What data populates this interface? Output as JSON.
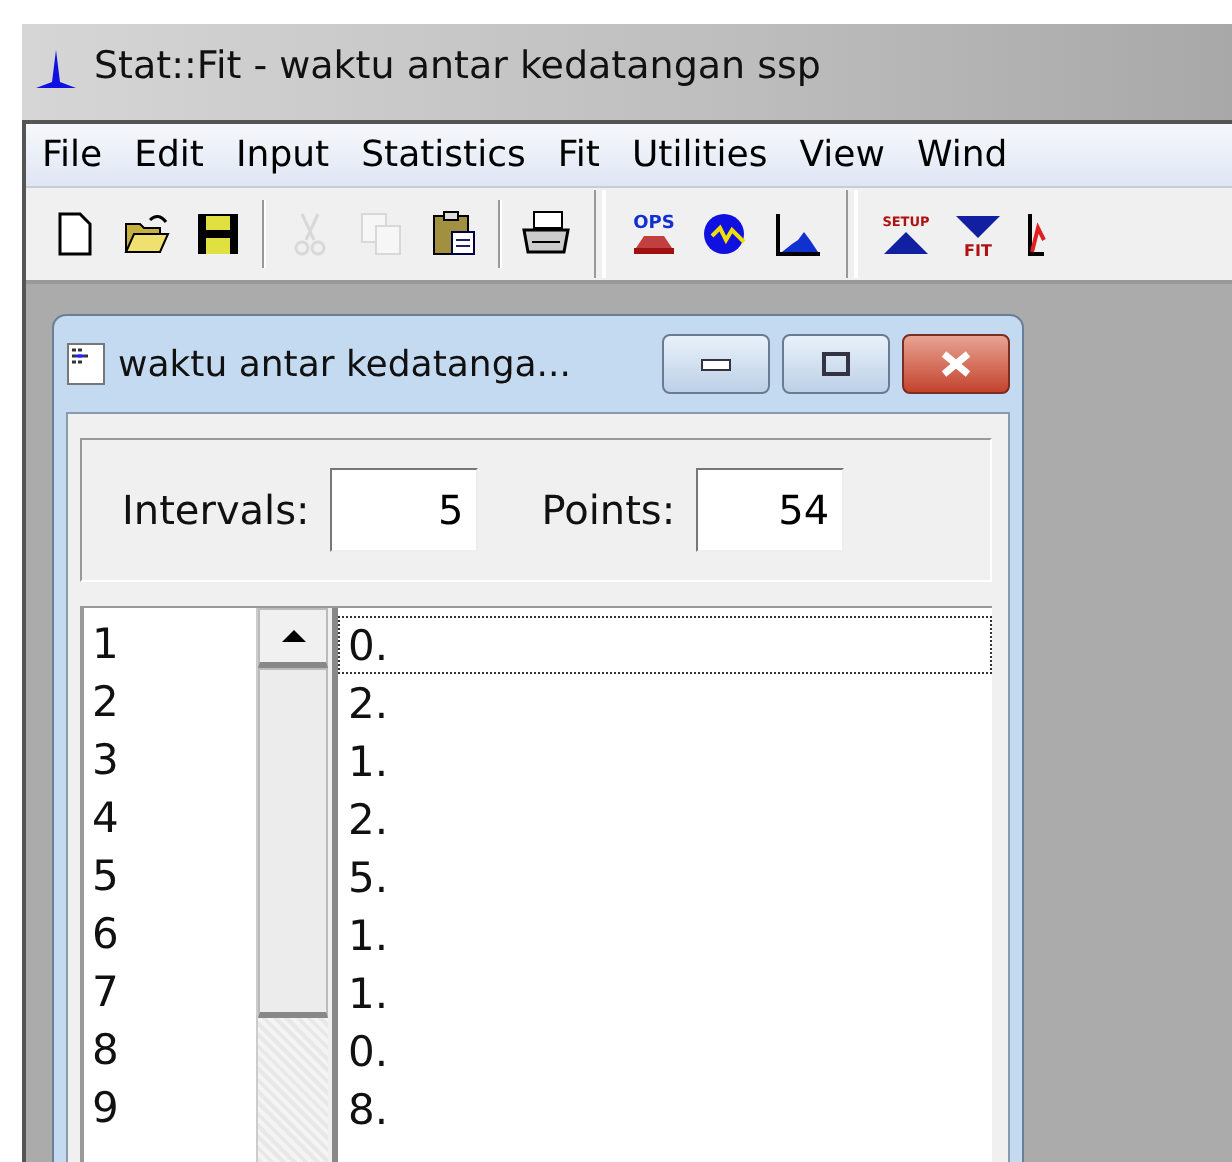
{
  "window": {
    "title": "Stat::Fit - waktu antar kedatangan ssp"
  },
  "menu": [
    "File",
    "Edit",
    "Input",
    "Statistics",
    "Fit",
    "Utilities",
    "View",
    "Wind"
  ],
  "toolbar": [
    {
      "kind": "new",
      "disabled": false
    },
    {
      "kind": "open",
      "disabled": false
    },
    {
      "kind": "save",
      "disabled": false
    },
    {
      "kind": "separator"
    },
    {
      "kind": "cut",
      "disabled": true
    },
    {
      "kind": "copy",
      "disabled": true
    },
    {
      "kind": "paste",
      "disabled": false
    },
    {
      "kind": "separator"
    },
    {
      "kind": "print",
      "disabled": false
    },
    {
      "kind": "group-break"
    },
    {
      "kind": "ops",
      "label": "OPS",
      "disabled": false
    },
    {
      "kind": "circle",
      "disabled": false
    },
    {
      "kind": "histogram",
      "disabled": false
    },
    {
      "kind": "group-break"
    },
    {
      "kind": "setup",
      "label": "SETUP",
      "disabled": false
    },
    {
      "kind": "fit",
      "label": "FIT",
      "disabled": false
    },
    {
      "kind": "chart",
      "disabled": false
    }
  ],
  "child_window": {
    "title": "waktu antar kedatanga...",
    "fields": [
      {
        "label": "Intervals:",
        "value": "5"
      },
      {
        "label": "Points:",
        "value": "54"
      }
    ],
    "rows": [
      {
        "index": "1",
        "value": "0.",
        "selected": true
      },
      {
        "index": "2",
        "value": "2.",
        "selected": false
      },
      {
        "index": "3",
        "value": "1.",
        "selected": false
      },
      {
        "index": "4",
        "value": "2.",
        "selected": false
      },
      {
        "index": "5",
        "value": "5.",
        "selected": false
      },
      {
        "index": "6",
        "value": "1.",
        "selected": false
      },
      {
        "index": "7",
        "value": "1.",
        "selected": false
      },
      {
        "index": "8",
        "value": "0.",
        "selected": false
      },
      {
        "index": "9",
        "value": "8.",
        "selected": false
      }
    ]
  }
}
